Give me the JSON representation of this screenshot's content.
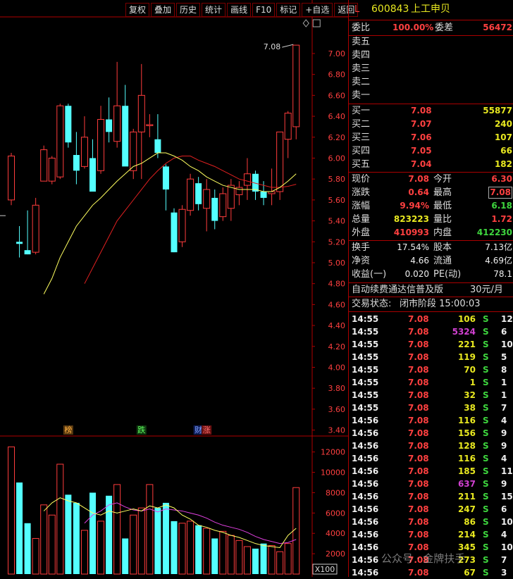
{
  "toolbar": {
    "items": [
      "复权",
      "叠加",
      "历史",
      "统计",
      "画线",
      "F10",
      "标记",
      "+自选",
      "返回"
    ]
  },
  "stock": {
    "market": "L",
    "code": "600843",
    "name": "上工申贝"
  },
  "order_book": {
    "wei_bi_label": "委比",
    "wei_bi": "100.00%",
    "wei_cha_label": "委差",
    "wei_cha": "56472",
    "asks": [
      {
        "label": "卖五",
        "price": "",
        "vol": ""
      },
      {
        "label": "卖四",
        "price": "",
        "vol": ""
      },
      {
        "label": "卖三",
        "price": "",
        "vol": ""
      },
      {
        "label": "卖二",
        "price": "",
        "vol": ""
      },
      {
        "label": "卖一",
        "price": "",
        "vol": ""
      }
    ],
    "bids": [
      {
        "label": "买一",
        "price": "7.08",
        "vol": "55877"
      },
      {
        "label": "买二",
        "price": "7.07",
        "vol": "240"
      },
      {
        "label": "买三",
        "price": "7.06",
        "vol": "107"
      },
      {
        "label": "买四",
        "price": "7.05",
        "vol": "66"
      },
      {
        "label": "买五",
        "price": "7.04",
        "vol": "182"
      }
    ]
  },
  "quote": [
    {
      "l1": "现价",
      "v1": "7.08",
      "l2": "今开",
      "v2": "6.30"
    },
    {
      "l1": "涨跌",
      "v1": "0.64",
      "l2": "最高",
      "v2": "7.08"
    },
    {
      "l1": "涨幅",
      "v1": "9.94%",
      "l2": "最低",
      "v2": "6.18"
    },
    {
      "l1": "总量",
      "v1": "823223",
      "l2": "量比",
      "v2": "1.72"
    },
    {
      "l1": "外盘",
      "v1": "410993",
      "l2": "内盘",
      "v2": "412230"
    }
  ],
  "stats": [
    {
      "l1": "换手",
      "v1": "17.54%",
      "l2": "股本",
      "v2": "7.13亿"
    },
    {
      "l1": "净资",
      "v1": "4.66",
      "l2": "流通",
      "v2": "4.69亿"
    },
    {
      "l1": "收益(一)",
      "v1": "0.020",
      "l2": "PE(动)",
      "v2": "78.1"
    }
  ],
  "promo": {
    "text": "自动续费通达信普及版",
    "price": "30元/月"
  },
  "trade_status": {
    "label": "交易状态:",
    "value": "闭市阶段 15:00:03"
  },
  "ticks": [
    {
      "t": "14:55",
      "p": "7.08",
      "v": "106",
      "s": "S",
      "n": "12"
    },
    {
      "t": "14:55",
      "p": "7.08",
      "v": "5324",
      "s": "S",
      "n": "6"
    },
    {
      "t": "14:55",
      "p": "7.08",
      "v": "221",
      "s": "S",
      "n": "10"
    },
    {
      "t": "14:55",
      "p": "7.08",
      "v": "119",
      "s": "S",
      "n": "5"
    },
    {
      "t": "14:55",
      "p": "7.08",
      "v": "70",
      "s": "S",
      "n": "8"
    },
    {
      "t": "14:55",
      "p": "7.08",
      "v": "1",
      "s": "S",
      "n": "1"
    },
    {
      "t": "14:55",
      "p": "7.08",
      "v": "32",
      "s": "S",
      "n": "1"
    },
    {
      "t": "14:55",
      "p": "7.08",
      "v": "38",
      "s": "S",
      "n": "7"
    },
    {
      "t": "14:56",
      "p": "7.08",
      "v": "116",
      "s": "S",
      "n": "4"
    },
    {
      "t": "14:56",
      "p": "7.08",
      "v": "156",
      "s": "S",
      "n": "9"
    },
    {
      "t": "14:56",
      "p": "7.08",
      "v": "128",
      "s": "S",
      "n": "9"
    },
    {
      "t": "14:56",
      "p": "7.08",
      "v": "116",
      "s": "S",
      "n": "4"
    },
    {
      "t": "14:56",
      "p": "7.08",
      "v": "185",
      "s": "S",
      "n": "11"
    },
    {
      "t": "14:56",
      "p": "7.08",
      "v": "637",
      "s": "S",
      "n": "9"
    },
    {
      "t": "14:56",
      "p": "7.08",
      "v": "211",
      "s": "S",
      "n": "15"
    },
    {
      "t": "14:56",
      "p": "7.08",
      "v": "247",
      "s": "S",
      "n": "6"
    },
    {
      "t": "14:56",
      "p": "7.08",
      "v": "86",
      "s": "S",
      "n": "10"
    },
    {
      "t": "14:56",
      "p": "7.08",
      "v": "214",
      "s": "S",
      "n": "4"
    },
    {
      "t": "14:56",
      "p": "7.08",
      "v": "345",
      "s": "S",
      "n": "10"
    },
    {
      "t": "14:56",
      "p": "7.08",
      "v": "273",
      "s": "S",
      "n": "7"
    },
    {
      "t": "14:56",
      "p": "7.08",
      "v": "67",
      "s": "S",
      "n": "3"
    }
  ],
  "watermark": "公众号 · 金牌扶手",
  "colors": {
    "up": "#ff3c3c",
    "down": "#54ffff",
    "ma5": "#ffff60",
    "ma10": "#e02020",
    "vma5": "#ffff60",
    "vma10": "#e040e0",
    "axis": "#b00000"
  },
  "chart_data": [
    {
      "type": "candlestick",
      "title": "",
      "yaxis_ticks": [
        "7.00",
        "6.80",
        "6.60",
        "6.40",
        "6.20",
        "6.00",
        "5.80",
        "5.60",
        "5.40",
        "5.20",
        "5.00",
        "4.80",
        "4.60",
        "4.40",
        "4.20",
        "4.00",
        "3.80",
        "3.60",
        "3.40"
      ],
      "ylim": [
        3.35,
        7.35
      ],
      "high_label": "7.08",
      "markers": [
        {
          "text": "榜",
          "index": 7
        },
        {
          "text": "跌",
          "index": 16
        },
        {
          "text": "财",
          "index": 23
        },
        {
          "text": "涨",
          "index": 24
        }
      ],
      "candles": [
        {
          "o": 5.6,
          "h": 6.05,
          "l": 5.55,
          "c": 6.02
        },
        {
          "o": 5.2,
          "h": 5.35,
          "l": 5.05,
          "c": 5.18
        },
        {
          "o": 5.12,
          "h": 5.5,
          "l": 5.08,
          "c": 5.08
        },
        {
          "o": 5.1,
          "h": 5.62,
          "l": 5.08,
          "c": 5.55
        },
        {
          "o": 5.78,
          "h": 6.12,
          "l": 5.78,
          "c": 6.08
        },
        {
          "o": 5.78,
          "h": 6.02,
          "l": 5.75,
          "c": 6.0
        },
        {
          "o": 5.82,
          "h": 6.52,
          "l": 5.8,
          "c": 6.5
        },
        {
          "o": 6.5,
          "h": 6.52,
          "l": 6.1,
          "c": 6.15
        },
        {
          "o": 6.03,
          "h": 6.25,
          "l": 5.75,
          "c": 5.88
        },
        {
          "o": 5.92,
          "h": 6.4,
          "l": 5.9,
          "c": 6.2
        },
        {
          "o": 6.0,
          "h": 6.18,
          "l": 5.75,
          "c": 5.68
        },
        {
          "o": 5.88,
          "h": 6.5,
          "l": 5.85,
          "c": 6.37
        },
        {
          "o": 6.37,
          "h": 6.58,
          "l": 6.15,
          "c": 6.25
        },
        {
          "o": 6.16,
          "h": 6.92,
          "l": 6.1,
          "c": 6.5
        },
        {
          "o": 6.5,
          "h": 6.7,
          "l": 5.95,
          "c": 5.92
        },
        {
          "o": 5.88,
          "h": 6.28,
          "l": 5.8,
          "c": 6.25
        },
        {
          "o": 6.25,
          "h": 6.9,
          "l": 5.8,
          "c": 6.6
        },
        {
          "o": 6.31,
          "h": 6.42,
          "l": 6.2,
          "c": 6.32
        },
        {
          "o": 6.18,
          "h": 6.42,
          "l": 6.0,
          "c": 6.05
        },
        {
          "o": 5.92,
          "h": 5.94,
          "l": 5.5,
          "c": 5.7
        },
        {
          "o": 5.48,
          "h": 5.52,
          "l": 5.1,
          "c": 5.1
        },
        {
          "o": 5.2,
          "h": 5.55,
          "l": 5.15,
          "c": 5.51
        },
        {
          "o": 5.5,
          "h": 5.85,
          "l": 5.45,
          "c": 5.8
        },
        {
          "o": 5.76,
          "h": 5.82,
          "l": 5.5,
          "c": 5.56
        },
        {
          "o": 5.52,
          "h": 5.8,
          "l": 5.3,
          "c": 5.7
        },
        {
          "o": 5.62,
          "h": 5.7,
          "l": 5.32,
          "c": 5.4
        },
        {
          "o": 5.44,
          "h": 5.72,
          "l": 5.4,
          "c": 5.66
        },
        {
          "o": 5.52,
          "h": 5.8,
          "l": 5.4,
          "c": 5.74
        },
        {
          "o": 5.65,
          "h": 5.78,
          "l": 5.55,
          "c": 5.72
        },
        {
          "o": 5.74,
          "h": 6.0,
          "l": 5.6,
          "c": 5.85
        },
        {
          "o": 5.85,
          "h": 5.88,
          "l": 5.6,
          "c": 5.68
        },
        {
          "o": 5.68,
          "h": 5.78,
          "l": 5.55,
          "c": 5.62
        },
        {
          "o": 5.66,
          "h": 5.9,
          "l": 5.55,
          "c": 5.68
        },
        {
          "o": 5.68,
          "h": 6.05,
          "l": 5.6,
          "c": 6.25
        },
        {
          "o": 6.18,
          "h": 6.45,
          "l": 6.0,
          "c": 6.43
        },
        {
          "o": 6.3,
          "h": 7.08,
          "l": 6.18,
          "c": 7.08
        }
      ],
      "ma5": [
        null,
        null,
        null,
        null,
        4.7,
        4.85,
        5.05,
        5.2,
        5.35,
        5.45,
        5.55,
        5.62,
        5.7,
        5.78,
        5.85,
        5.92,
        5.95,
        6.0,
        6.05,
        6.05,
        6.02,
        5.98,
        5.92,
        5.88,
        5.82,
        5.78,
        5.74,
        5.72,
        5.7,
        5.7,
        5.7,
        5.68,
        5.68,
        5.72,
        5.78,
        5.85
      ],
      "ma10": [
        null,
        null,
        null,
        null,
        null,
        null,
        null,
        null,
        null,
        4.8,
        4.95,
        5.1,
        5.25,
        5.4,
        5.5,
        5.6,
        5.7,
        5.8,
        5.88,
        5.95,
        6.0,
        6.02,
        6.02,
        5.98,
        5.95,
        5.92,
        5.88,
        5.84,
        5.8,
        5.78,
        5.76,
        5.74,
        5.72,
        5.72,
        5.73,
        5.75
      ]
    },
    {
      "type": "bar",
      "title": "",
      "unit_label": "X100",
      "yaxis_ticks": [
        "12000",
        "10000",
        "8000",
        "6000",
        "4000",
        "2000"
      ],
      "ylim": [
        0,
        13500
      ],
      "volumes": [
        12500,
        9000,
        5000,
        3500,
        6800,
        5800,
        10800,
        7800,
        7000,
        4300,
        8000,
        5200,
        7700,
        8800,
        3500,
        5800,
        6500,
        8800,
        6500,
        7000,
        5200,
        5000,
        5200,
        4800,
        4500,
        3500,
        4200,
        3800,
        3300,
        2700,
        2500,
        3000,
        2800,
        2200,
        3000,
        8500
      ],
      "vma5": [
        null,
        null,
        null,
        null,
        6200,
        7000,
        7500,
        7200,
        7000,
        6500,
        6000,
        5800,
        6200,
        6000,
        6200,
        6400,
        6200,
        6700,
        6500,
        6800,
        6500,
        5800,
        5400,
        4800,
        4600,
        4300,
        4100,
        3800,
        3600,
        3300,
        3000,
        2800,
        2700,
        2600,
        3800,
        4500
      ],
      "vma10": [
        null,
        null,
        null,
        null,
        null,
        null,
        null,
        null,
        null,
        5000,
        5800,
        6200,
        6800,
        7000,
        6600,
        6300,
        6200,
        6400,
        6100,
        6400,
        6300,
        6200,
        6000,
        5800,
        5500,
        5100,
        4800,
        4600,
        4400,
        4100,
        3700,
        3400,
        3200,
        3000,
        3100,
        3400
      ]
    }
  ]
}
